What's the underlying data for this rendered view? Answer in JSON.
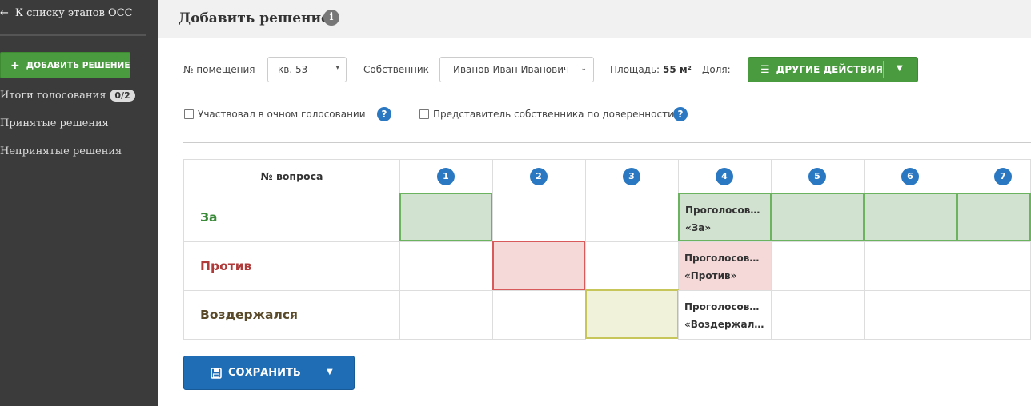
{
  "sidebar": {
    "back_label": "К списку этапов ОСС",
    "add_button_label": "ДОБАВИТЬ РЕШЕНИЕ",
    "items": [
      {
        "label": "Итоги голосования",
        "badge": "0/2"
      },
      {
        "label": "Принятые решения"
      },
      {
        "label": "Непринятые решения"
      }
    ]
  },
  "header": {
    "title": "Добавить решение"
  },
  "form": {
    "room_label": "№ помещения",
    "room_value": "кв. 53",
    "owner_label": "Собственник",
    "owner_value": "Иванов Иван Иванович",
    "area_label": "Площадь:",
    "area_value": "55 м²",
    "share_label": "Доля:",
    "actions_label": "ДРУГИЕ ДЕЙСТВИЯ",
    "checkbox_inperson": "Участвовал в очном голосовании",
    "checkbox_proxy": "Представитель собственника по доверенности"
  },
  "table": {
    "header_label": "№ вопроса",
    "questions": [
      "1",
      "2",
      "3",
      "4",
      "5",
      "6",
      "7"
    ],
    "rows": [
      {
        "label": "За"
      },
      {
        "label": "Против"
      },
      {
        "label": "Воздержался"
      }
    ],
    "voted_texts": {
      "for_line1": "Проголосов…",
      "for_line2": "«За»",
      "against_line1": "Проголосов…",
      "against_line2": "«Против»",
      "abstain_line1": "Проголосов…",
      "abstain_line2": "«Воздержал…"
    }
  },
  "save_label": "СОХРАНИТЬ",
  "colors": {
    "sidebar_bg": "#3b3b3b",
    "green_button": "#4a9a3f",
    "blue_button": "#1e6db5",
    "question_circle": "#2a78c2"
  }
}
